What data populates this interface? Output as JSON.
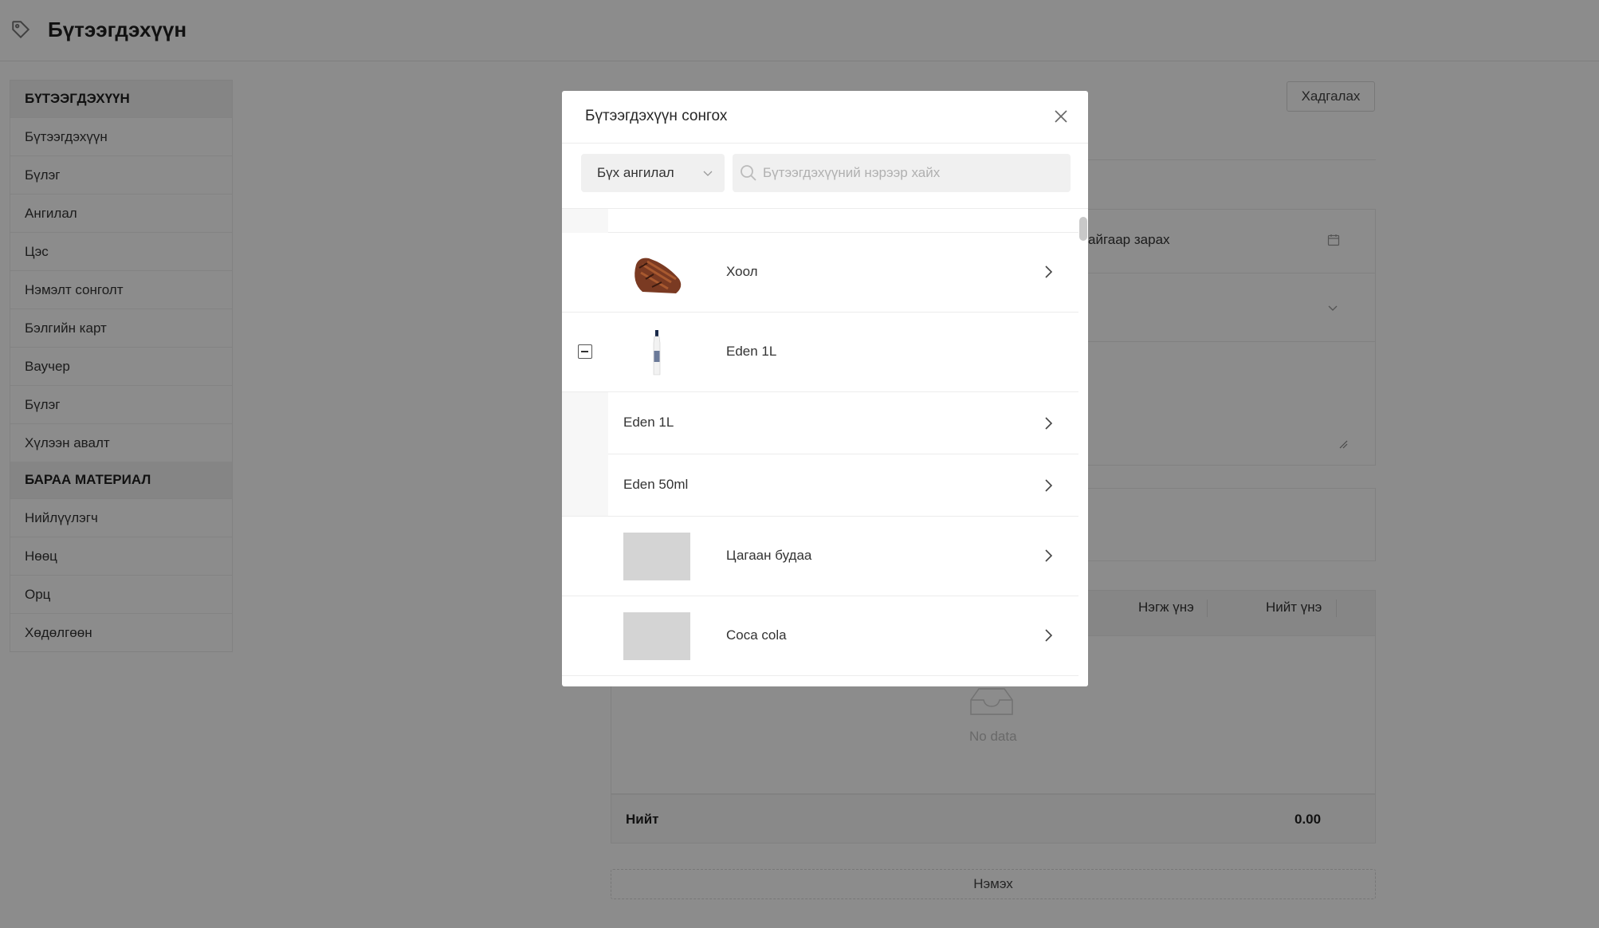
{
  "header": {
    "title": "Бүтээгдэхүүн"
  },
  "sidebar": {
    "sections": [
      {
        "title": "БҮТЭЭГДЭХҮҮН",
        "items": [
          "Бүтээгдэхүүн",
          "Бүлэг",
          "Ангилал",
          "Цэс",
          "Нэмэлт сонголт",
          "Бэлгийн карт",
          "Ваучер",
          "Бүлэг",
          "Хүлээн авалт"
        ]
      },
      {
        "title": "БАРАА МАТЕРИАЛ",
        "items": [
          "Нийлүүлэгч",
          "Нөөц",
          "Орц",
          "Хөдөлгөөн"
        ]
      }
    ]
  },
  "main": {
    "save_label": "Хадгалах",
    "sell_text": "айгаар зарах",
    "table": {
      "unit_price": "Нэгж үнэ",
      "total_price": "Нийт үнэ"
    },
    "empty_text": "No data",
    "total_label": "Нийт",
    "total_value": "0.00",
    "add_label": "Нэмэх"
  },
  "modal": {
    "title": "Бүтээгдэхүүн сонгох",
    "category_select": "Бүх ангилал",
    "search_placeholder": "Бүтээгдэхүүний нэрээр хайх",
    "rows": [
      {
        "name": "Хоол"
      },
      {
        "name": "Eden 1L",
        "expanded": true,
        "variants": [
          "Eden 1L",
          "Eden 50ml"
        ]
      },
      {
        "name": "Цагаан будаа"
      },
      {
        "name": "Coca cola"
      }
    ]
  },
  "colors": {
    "overlay": "#737373",
    "modal_bg": "#ffffff",
    "input_bg": "#f0f0f0",
    "placeholder_thumb": "#d4d4d4"
  }
}
